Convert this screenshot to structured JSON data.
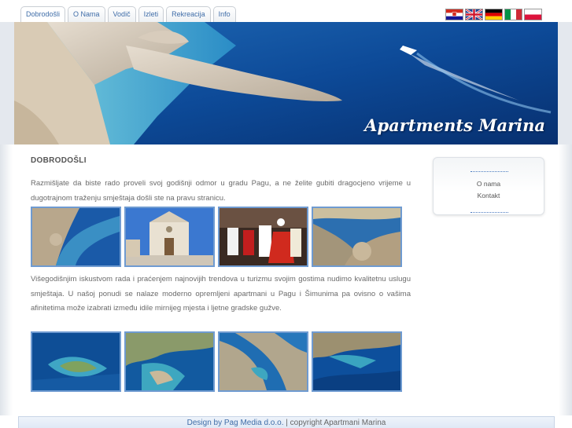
{
  "nav": {
    "tabs": [
      "Dobrodošli",
      "O Nama",
      "Vodič",
      "Izleti",
      "Rekreacija",
      "Info"
    ]
  },
  "languages": [
    "hr-flag",
    "uk-flag",
    "de-flag",
    "it-flag",
    "pl-flag"
  ],
  "banner": {
    "title": "Apartments Marina"
  },
  "main": {
    "heading": "DOBRODOŠLI",
    "paragraph1": "Razmišljate da biste rado proveli svoj godišnji odmor u gradu Pagu, a ne želite gubiti dragocjeno vrijeme u dugotrajnom traženju smještaja došli ste na pravu stranicu.",
    "paragraph2": "Višegodišnjim iskustvom rada i praćenjem najnovijih trendova u turizmu svojim gostima nudimo kvalitetnu uslugu smještaja. U našoj ponudi se nalaze moderno opremljeni apartmani u Pagu i Šimunima pa ovisno o vašima afinitetima može izabrati između idile mirnijeg mjesta i ljetne gradske gužve."
  },
  "subnav": {
    "link1": "O nama",
    "link2": "Kontakt"
  },
  "footer": {
    "design": "Design by Pag Media d.o.o.",
    "separator": " | ",
    "copyright": "copyright Apartmani Marina"
  },
  "colors": {
    "link": "#3f6da8",
    "thumb_border": "#6f9bd1",
    "banner_sea": "#0c3f86"
  }
}
